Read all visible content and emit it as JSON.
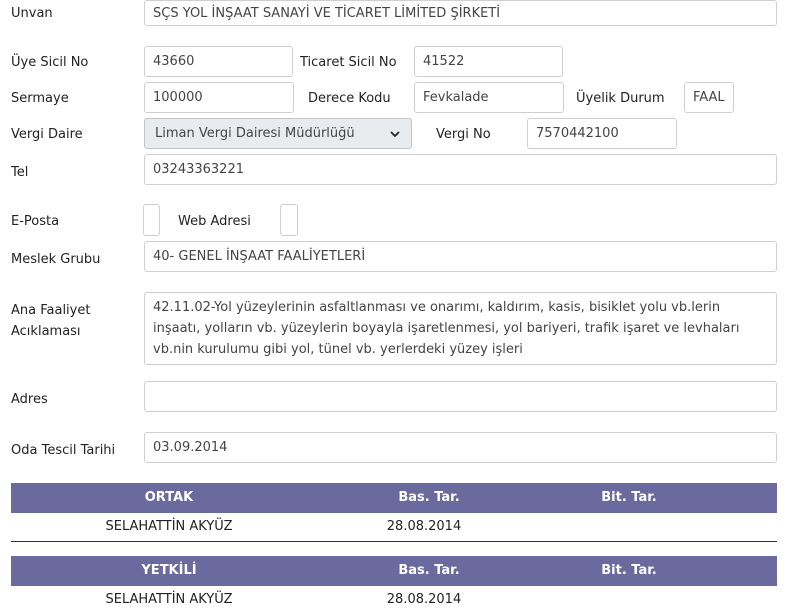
{
  "form": {
    "unvan": {
      "label": "Unvan",
      "value": "SÇS YOL İNŞAAT SANAYİ VE TİCARET LİMİTED ŞİRKETİ"
    },
    "uye_sicil_no": {
      "label": "Üye Sicil No",
      "value": "43660"
    },
    "ticaret_sicil_no": {
      "label": "Ticaret Sicil No",
      "value": "41522"
    },
    "sermaye": {
      "label": "Sermaye",
      "value": "100000"
    },
    "derece_kodu": {
      "label": "Derece Kodu",
      "value": "Fevkalade"
    },
    "uyelik_durum": {
      "label": "Üyelik Durum",
      "value": "FAAL"
    },
    "vergi_daire": {
      "label": "Vergi Daire",
      "value": "Liman Vergi Dairesi Müdürlüğü"
    },
    "vergi_no": {
      "label": "Vergi No",
      "value": "7570442100"
    },
    "tel": {
      "label": "Tel",
      "value": "03243363221"
    },
    "e_posta": {
      "label": "E-Posta",
      "value": ""
    },
    "web_adresi": {
      "label": "Web Adresi",
      "value": ""
    },
    "meslek_grubu": {
      "label": "Meslek Grubu",
      "value": "40- GENEL İNŞAAT FAALİYETLERİ"
    },
    "ana_faaliyet": {
      "label_line1": "Ana Faaliyet",
      "label_line2": "Acıklaması",
      "value": "42.11.02-Yol yüzeylerinin asfaltlanması ve onarımı, kaldırım, kasis, bisiklet yolu vb.lerin inşaatı, yolların vb. yüzeylerin boyayla işaretlenmesi, yol bariyeri, trafik işaret ve levhaları vb.nin kurulumu gibi yol, tünel vb. yerlerdeki yüzey işleri"
    },
    "adres": {
      "label": "Adres",
      "value": ""
    },
    "oda_tescil_tarihi": {
      "label": "Oda Tescil Tarihi",
      "value": "03.09.2014"
    }
  },
  "ortak_table": {
    "headers": [
      "ORTAK",
      "Bas. Tar.",
      "Bit. Tar."
    ],
    "rows": [
      {
        "name": "SELAHATTİN  AKYÜZ",
        "bas": "28.08.2014",
        "bit": ""
      }
    ]
  },
  "yetkili_table": {
    "headers": [
      "YETKİLİ",
      "Bas. Tar.",
      "Bit. Tar."
    ],
    "rows": [
      {
        "name": "SELAHATTİN  AKYÜZ",
        "bas": "28.08.2014",
        "bit": ""
      }
    ]
  },
  "icons": {
    "select_arrow": "chevron-down-icon"
  },
  "colors": {
    "table_header_bg": "#6a6a9e",
    "input_border": "#cfcfcf",
    "select_bg": "#e9ecef"
  }
}
